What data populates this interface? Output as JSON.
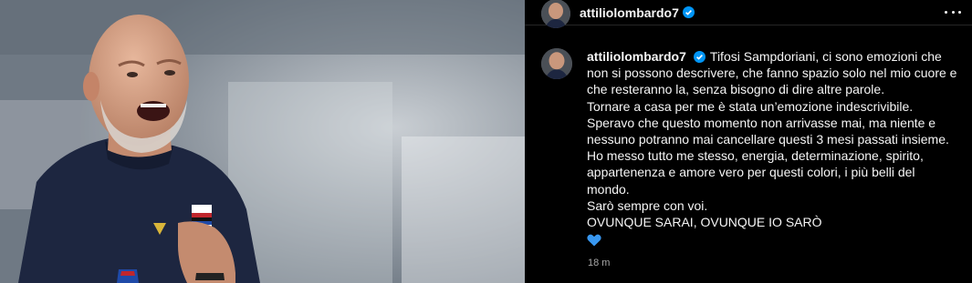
{
  "colors": {
    "background": "#000000",
    "text": "#f5f5f5",
    "muted": "#a8a8a8",
    "verified_badge": "#0095f6",
    "heart": "#3897f0"
  },
  "header": {
    "username": "attiliolombardo7",
    "verified_icon": "verified-badge-icon",
    "more_icon": "more-options-icon"
  },
  "post": {
    "username": "attiliolombardo7",
    "caption_lines": [
      "Tifosi Sampdoriani, ci sono emozioni che",
      "non si possono descrivere, che fanno spazio solo nel mio cuore e",
      "che resteranno la, senza bisogno di dire altre parole.",
      "Tornare a casa per me è stata un’emozione indescrivibile.",
      "Speravo che questo momento non arrivasse mai, ma niente e",
      "nessuno potranno mai cancellare questi 3 mesi passati insieme.",
      "Ho messo tutto me stesso, energia, determinazione, spirito,",
      "appartenenza e amore vero per questi colori, i più belli del",
      "mondo.",
      "Sarò sempre con voi.",
      "OVUNQUE SARAI, OVUNQUE IO SARÒ"
    ],
    "emoji_icon": "blue-heart-icon",
    "timestamp": "18 m"
  }
}
